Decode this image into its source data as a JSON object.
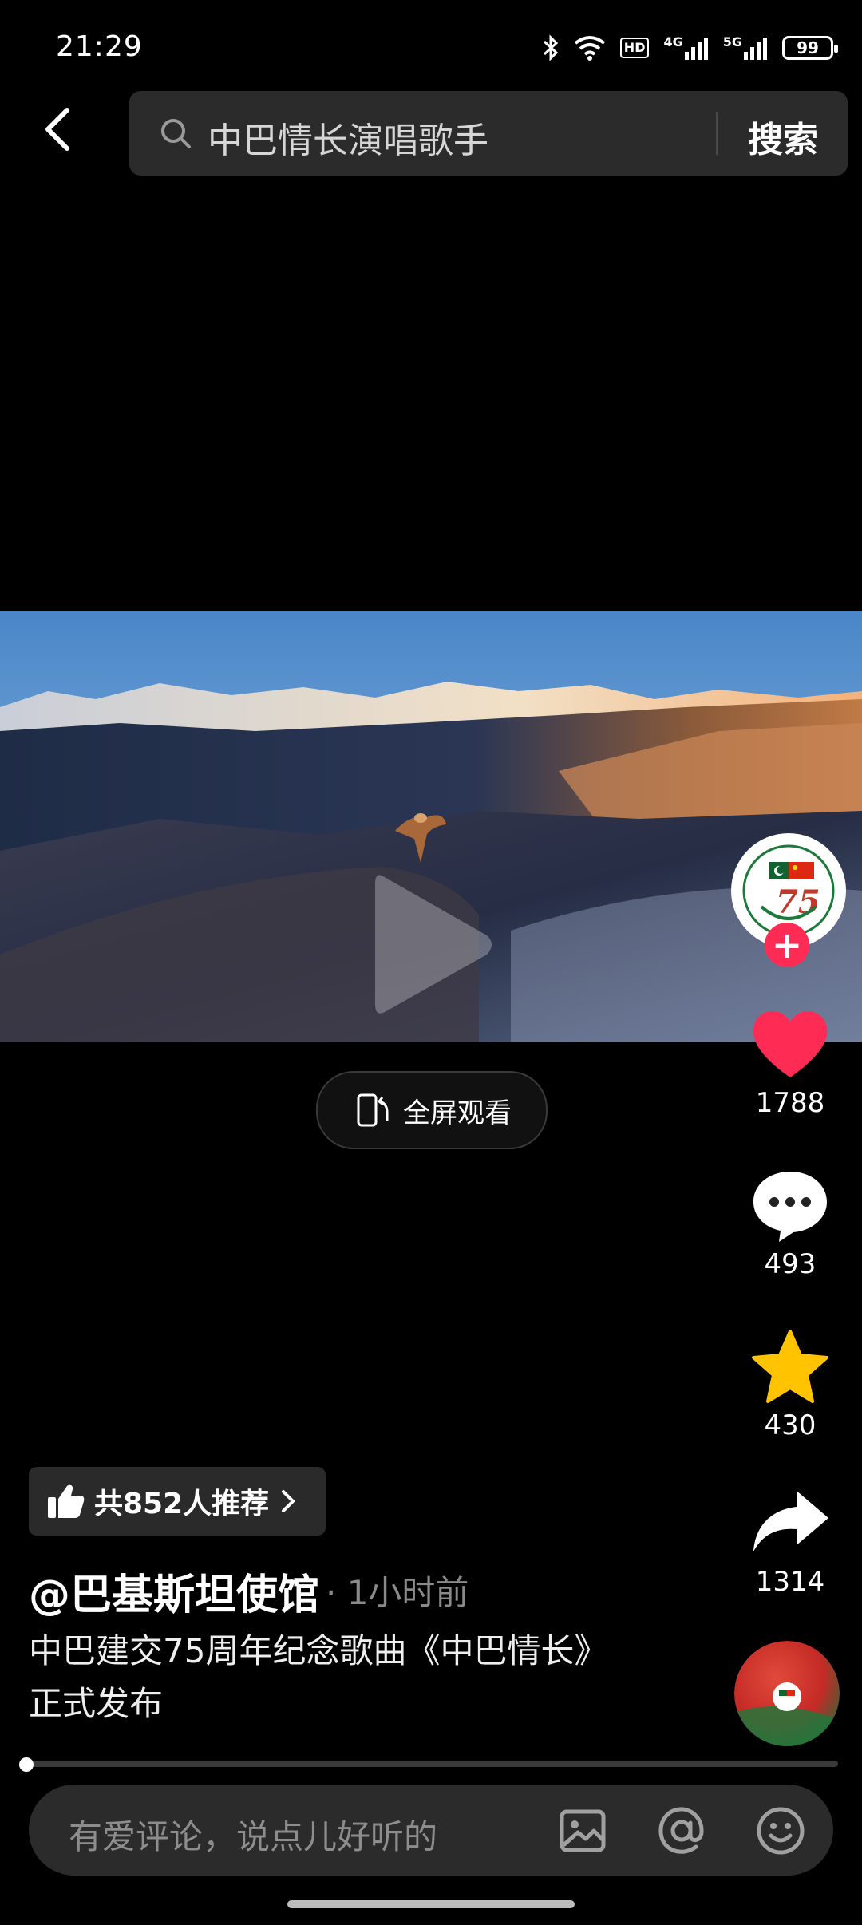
{
  "status_bar": {
    "time": "21:29",
    "battery": "99",
    "net1": "4G",
    "net2": "5G",
    "hd": "HD"
  },
  "search": {
    "query": "中巴情长演唱歌手",
    "button": "搜索"
  },
  "video": {
    "fullscreen_label": "全屏观看"
  },
  "rail": {
    "likes": "1788",
    "comments": "493",
    "favorites": "430",
    "shares": "1314"
  },
  "post": {
    "recommend": "共852人推荐",
    "author": "@巴基斯坦使馆",
    "time": "· 1小时前",
    "description": "中巴建交75周年纪念歌曲《中巴情长》正式发布"
  },
  "progress": 0,
  "comment_bar": {
    "placeholder": "有爱评论，说点儿好听的"
  },
  "colors": {
    "like": "#fe2c55",
    "star": "#ffc300",
    "follow": "#fe2c55"
  }
}
